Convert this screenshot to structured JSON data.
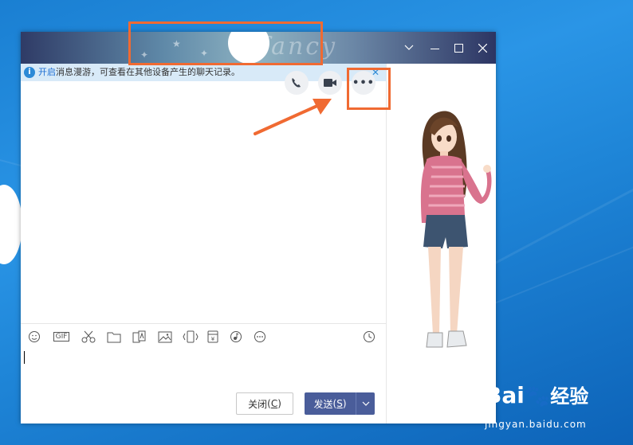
{
  "window": {
    "title_deco": "fancy",
    "controls": [
      "chevron-down-icon",
      "minimize-icon",
      "maximize-icon",
      "close-icon"
    ]
  },
  "notice": {
    "link_text": "开启",
    "message": "消息漫游，可查看在其他设备产生的聊天记录。",
    "close_glyph": "✕"
  },
  "call_actions": [
    "phone-icon",
    "video-call-icon",
    "more-icon"
  ],
  "toolbar": {
    "items": [
      "emoji-icon",
      "gif-icon",
      "screenshot-scissors-icon",
      "folder-icon",
      "font-style-icon",
      "image-icon",
      "shake-icon",
      "red-packet-icon",
      "music-icon",
      "more-icon",
      "history-clock-icon"
    ],
    "gif_label": "GIF"
  },
  "buttons": {
    "close_label": "关闭",
    "close_hotkey": "C",
    "send_label": "发送",
    "send_hotkey": "S"
  },
  "colors": {
    "accent": "#4a5d9a",
    "highlight": "#f06a32",
    "notice_bg": "#d8eaf8",
    "link": "#1f6fd2"
  },
  "watermark": {
    "brand_en": "Bai",
    "brand_cn": "经验",
    "url": "jingyan.baidu.com"
  }
}
